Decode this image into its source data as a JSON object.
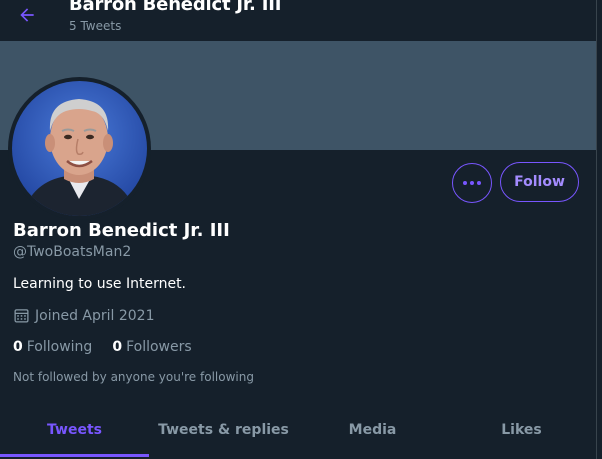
{
  "header": {
    "title": "Barron Benedict Jr. III",
    "subtitle": "5 Tweets",
    "back_icon": "arrow-left-icon"
  },
  "profile": {
    "name": "Barron Benedict Jr. III",
    "handle": "@TwoBoatsMan2",
    "bio": "Learning to use Internet.",
    "joined": "Joined April 2021",
    "following_count": "0",
    "following_label": "Following",
    "followers_count": "0",
    "followers_label": "Followers",
    "not_followed": "Not followed by anyone you're following"
  },
  "actions": {
    "more_icon": "more-dots-icon",
    "follow_label": "Follow"
  },
  "tabs": [
    {
      "label": "Tweets",
      "active": true
    },
    {
      "label": "Tweets & replies",
      "active": false
    },
    {
      "label": "Media",
      "active": false
    },
    {
      "label": "Likes",
      "active": false
    }
  ],
  "colors": {
    "background": "#15202b",
    "banner": "#3e5466",
    "accent": "#7856ff",
    "secondary_text": "#8899a6"
  }
}
